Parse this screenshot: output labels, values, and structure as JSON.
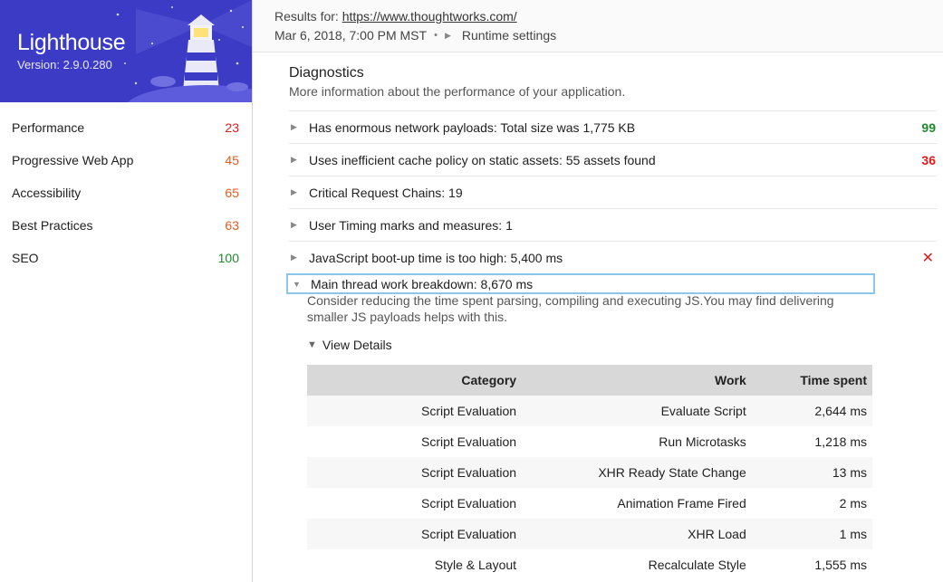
{
  "sidebar": {
    "title": "Lighthouse",
    "version": "Version: 2.9.0.280",
    "categories": [
      {
        "label": "Performance",
        "score": "23",
        "color": "#e01b1b"
      },
      {
        "label": "Progressive Web App",
        "score": "45",
        "color": "#e65a1a"
      },
      {
        "label": "Accessibility",
        "score": "65",
        "color": "#e65a1a"
      },
      {
        "label": "Best Practices",
        "score": "63",
        "color": "#e65a1a"
      },
      {
        "label": "SEO",
        "score": "100",
        "color": "#1f8a2b"
      }
    ]
  },
  "header": {
    "results_label": "Results for:",
    "url": "https://www.thoughtworks.com/",
    "date": "Mar 6, 2018, 7:00 PM MST",
    "separator": "•",
    "runtime_settings": "Runtime settings"
  },
  "diagnostics": {
    "title": "Diagnostics",
    "description": "More information about the performance of your application.",
    "audits": [
      {
        "title": "Has enormous network payloads: Total size was 1,775 KB",
        "score": "99",
        "score_color": "#1f8a2b"
      },
      {
        "title": "Uses inefficient cache policy on static assets: 55 assets found",
        "score": "36",
        "score_color": "#e01b1b"
      },
      {
        "title": "Critical Request Chains: 19",
        "score": ""
      },
      {
        "title": "User Timing marks and measures: 1",
        "score": ""
      },
      {
        "title": "JavaScript boot-up time is too high: 5,400 ms",
        "fail_mark": "✕"
      }
    ],
    "expanded_audit": {
      "title": "Main thread work breakdown: 8,670 ms",
      "help": "Consider reducing the time spent parsing, compiling and executing JS.You may find delivering smaller JS payloads helps with this.",
      "view_details": "View Details",
      "table": {
        "headers": [
          "Category",
          "Work",
          "Time spent"
        ],
        "rows": [
          [
            "Script Evaluation",
            "Evaluate Script",
            "2,644 ms"
          ],
          [
            "Script Evaluation",
            "Run Microtasks",
            "1,218 ms"
          ],
          [
            "Script Evaluation",
            "XHR Ready State Change",
            "13 ms"
          ],
          [
            "Script Evaluation",
            "Animation Frame Fired",
            "2 ms"
          ],
          [
            "Script Evaluation",
            "XHR Load",
            "1 ms"
          ],
          [
            "Style & Layout",
            "Recalculate Style",
            "1,555 ms"
          ]
        ]
      }
    }
  }
}
